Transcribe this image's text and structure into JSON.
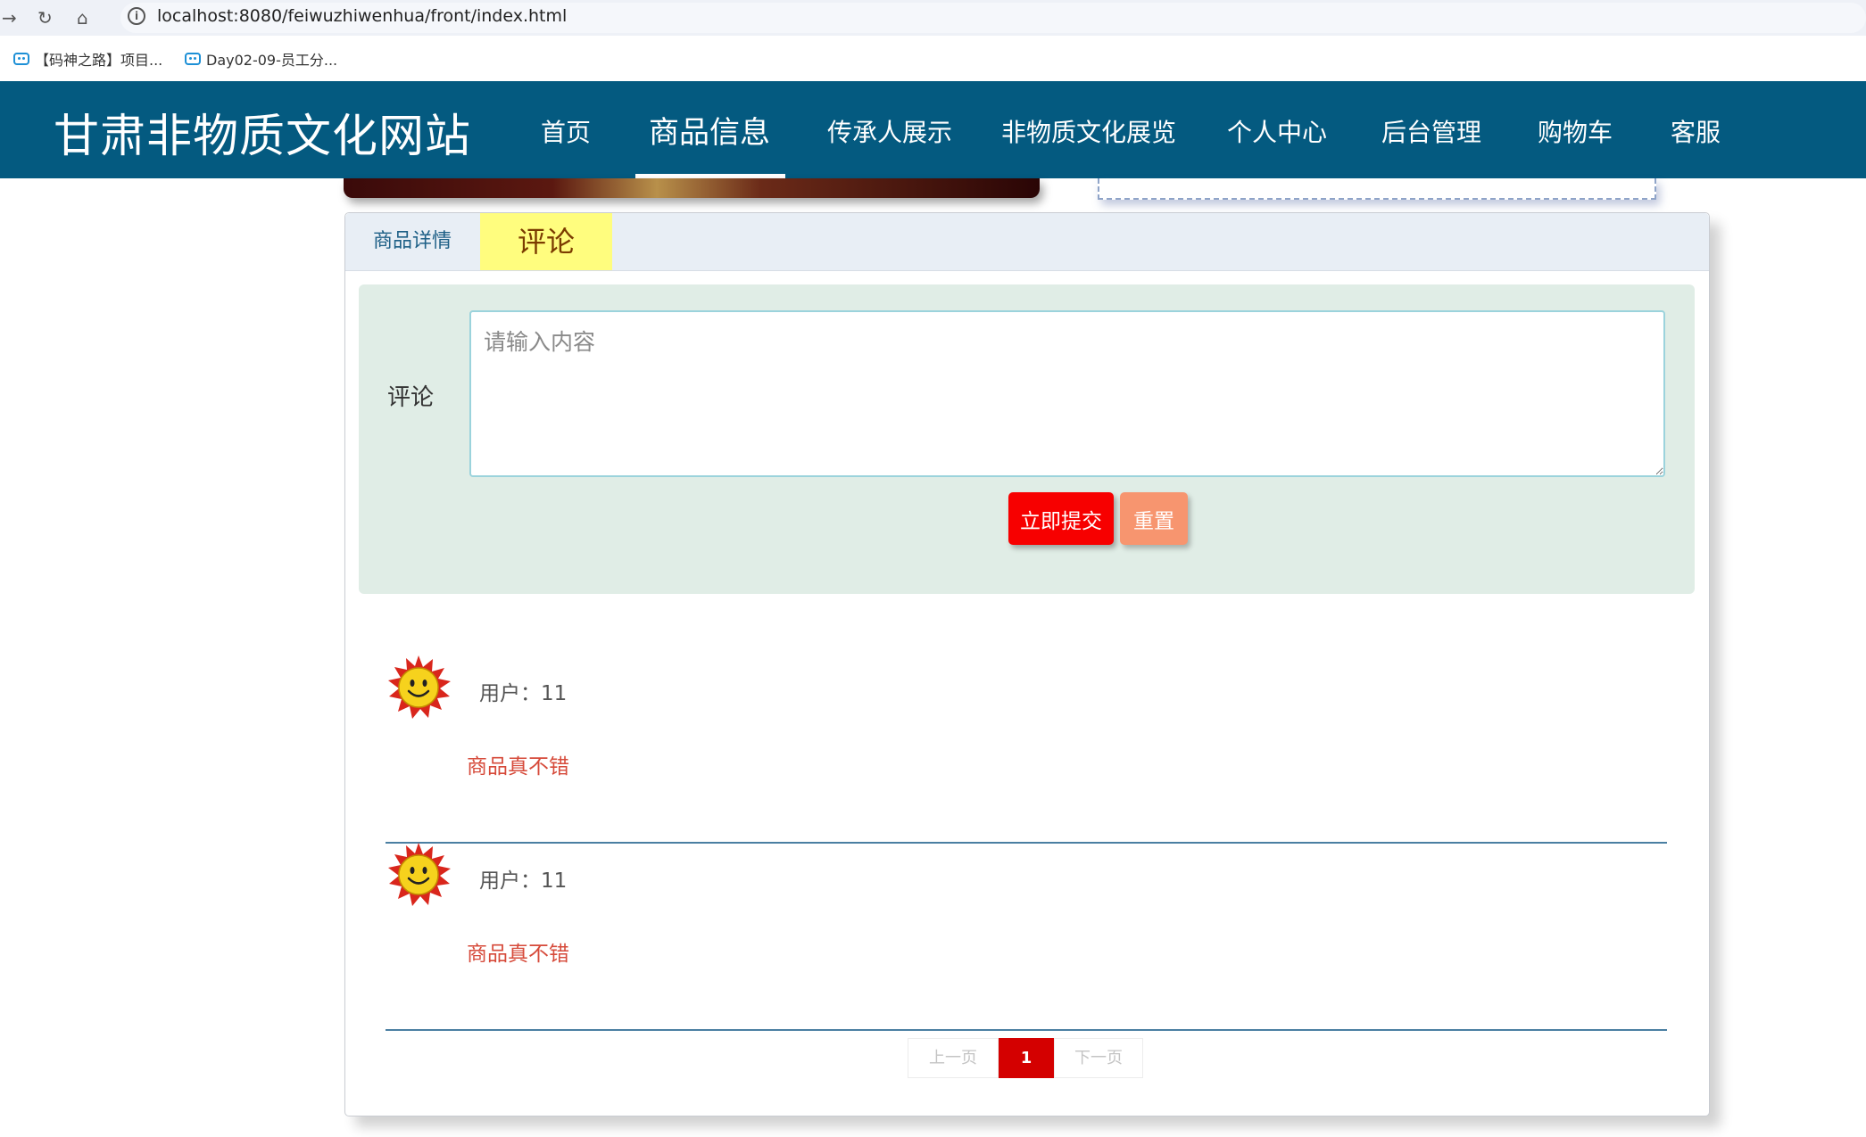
{
  "browser": {
    "url": "localhost:8080/feiwuzhiwenhua/front/index.html",
    "bookmarks": [
      {
        "label": "【码神之路】项目..."
      },
      {
        "label": "Day02-09-员工分..."
      }
    ]
  },
  "site": {
    "title": "甘肃非物质文化网站",
    "menu": [
      {
        "label": "首页"
      },
      {
        "label": "商品信息"
      },
      {
        "label": "传承人展示"
      },
      {
        "label": "非物质文化展览"
      },
      {
        "label": "个人中心"
      },
      {
        "label": "后台管理"
      },
      {
        "label": "购物车"
      },
      {
        "label": "客服"
      }
    ],
    "active_menu": "商品信息"
  },
  "tabs": [
    {
      "label": "商品详情"
    },
    {
      "label": "评论"
    }
  ],
  "form": {
    "label": "评论",
    "placeholder": "请输入内容",
    "value": "",
    "submit_label": "立即提交",
    "reset_label": "重置"
  },
  "comments": [
    {
      "user": "用户：11",
      "text": "商品真不错"
    },
    {
      "user": "用户：11",
      "text": "商品真不错"
    }
  ],
  "pagination": {
    "prev_label": "上一页",
    "current": "1",
    "next_label": "下一页"
  },
  "colors": {
    "header_bg": "#045a80",
    "active_tab_bg": "#fffd7e",
    "submit_bg": "#f70000",
    "reset_bg": "#f7956f",
    "comment_text": "#d64a3a"
  }
}
